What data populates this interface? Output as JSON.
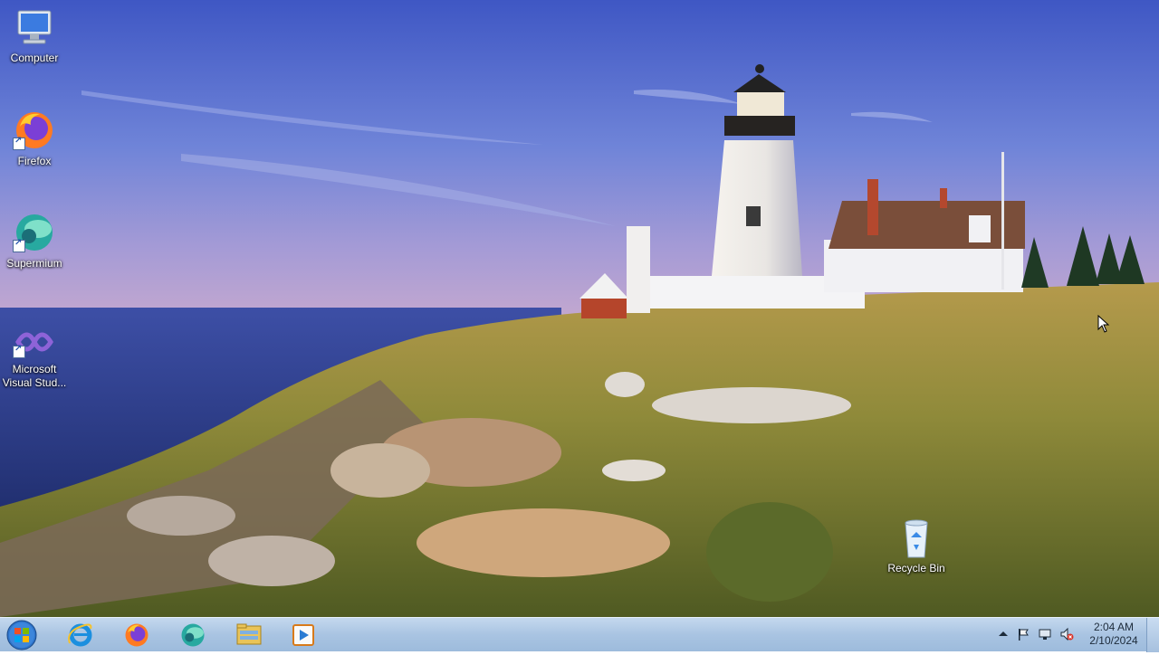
{
  "desktop": {
    "icons": [
      {
        "label": "Computer"
      },
      {
        "label": "Firefox"
      },
      {
        "label": "Supermium"
      },
      {
        "label": "Microsoft Visual Stud..."
      },
      {
        "label": "Recycle Bin"
      }
    ]
  },
  "taskbar": {
    "pinned": [
      "internet-explorer-icon",
      "firefox-icon",
      "supermium-icon",
      "file-explorer-icon",
      "media-player-icon"
    ],
    "clock": {
      "time": "2:04 AM",
      "date": "2/10/2024"
    }
  },
  "colors": {
    "taskbar": "#a9c4e2",
    "sky": "#4a63c9",
    "sea": "#2b3f8a"
  }
}
